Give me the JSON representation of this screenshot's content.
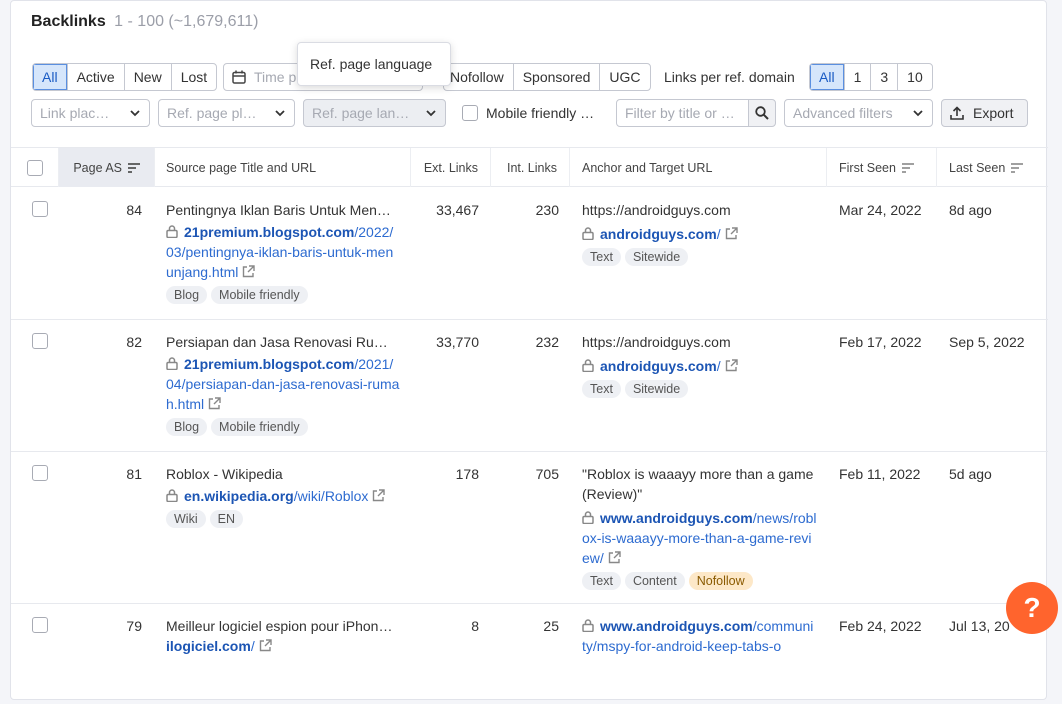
{
  "header": {
    "title": "Backlinks",
    "count": "1 - 100 (~1,679,611)"
  },
  "filters": {
    "status_tabs": [
      "All",
      "Active",
      "New",
      "Lost"
    ],
    "time_period_placeholder": "Time p",
    "type_tabs": [
      "Nofollow",
      "Sponsored",
      "UGC"
    ],
    "links_per_domain_label": "Links per ref. domain",
    "links_per_domain_options": [
      "All",
      "1",
      "3",
      "10"
    ],
    "link_placement": "Link plac…",
    "ref_page_platform": "Ref. page pl…",
    "ref_page_language": "Ref. page lan…",
    "mobile_friendly": "Mobile friendly …",
    "search_placeholder": "Filter by title or …",
    "advanced_filters": "Advanced filters",
    "export": "Export"
  },
  "tooltip": {
    "text": "Ref. page language"
  },
  "columns": {
    "page_as": "Page AS",
    "source": "Source page Title and URL",
    "ext_links": "Ext. Links",
    "int_links": "Int. Links",
    "anchor": "Anchor and Target URL",
    "first_seen": "First Seen",
    "last_seen": "Last Seen"
  },
  "rows": [
    {
      "page_as": "84",
      "title": "Pentingnya Iklan Baris Untuk Men…",
      "url_domain": "21premium.blogspot.com",
      "url_path": "/2022/03/pentingnya-iklan-baris-untuk-menunjang.html",
      "tags": [
        "Blog",
        "Mobile friendly"
      ],
      "ext_links": "33,467",
      "int_links": "230",
      "anchor": "https://androidguys.com",
      "target_domain": "androidguys.com",
      "target_path": "/",
      "anchor_tags": [
        "Text",
        "Sitewide"
      ],
      "first_seen": "Mar 24, 2022",
      "last_seen": "8d ago"
    },
    {
      "page_as": "82",
      "title": "Persiapan dan Jasa Renovasi Ru…",
      "url_domain": "21premium.blogspot.com",
      "url_path": "/2021/04/persiapan-dan-jasa-renovasi-rumah.html",
      "tags": [
        "Blog",
        "Mobile friendly"
      ],
      "ext_links": "33,770",
      "int_links": "232",
      "anchor": "https://androidguys.com",
      "target_domain": "androidguys.com",
      "target_path": "/",
      "anchor_tags": [
        "Text",
        "Sitewide"
      ],
      "first_seen": "Feb 17, 2022",
      "last_seen": "Sep 5, 2022"
    },
    {
      "page_as": "81",
      "title": "Roblox - Wikipedia",
      "url_domain": "en.wikipedia.org",
      "url_path": "/wiki/Roblox",
      "tags": [
        "Wiki",
        "EN"
      ],
      "ext_links": "178",
      "int_links": "705",
      "anchor": "\"Roblox is waaayy more than a game (Review)\"",
      "target_domain": "www.androidguys.com",
      "target_path": "/news/roblox-is-waaayy-more-than-a-game-review/",
      "anchor_tags": [
        "Text",
        "Content",
        "Nofollow"
      ],
      "first_seen": "Feb 11, 2022",
      "last_seen": "5d ago"
    },
    {
      "page_as": "79",
      "title": "Meilleur logiciel espion pour iPhon…",
      "url_domain": "ilogiciel.com",
      "url_path": "/",
      "tags": [],
      "ext_links": "8",
      "int_links": "25",
      "anchor": "",
      "target_domain": "www.androidguys.com",
      "target_path": "/community/mspy-for-android-keep-tabs-o",
      "anchor_tags": [],
      "first_seen": "Feb 24, 2022",
      "last_seen": "Jul 13, 20"
    }
  ],
  "help": {
    "label": "?"
  }
}
